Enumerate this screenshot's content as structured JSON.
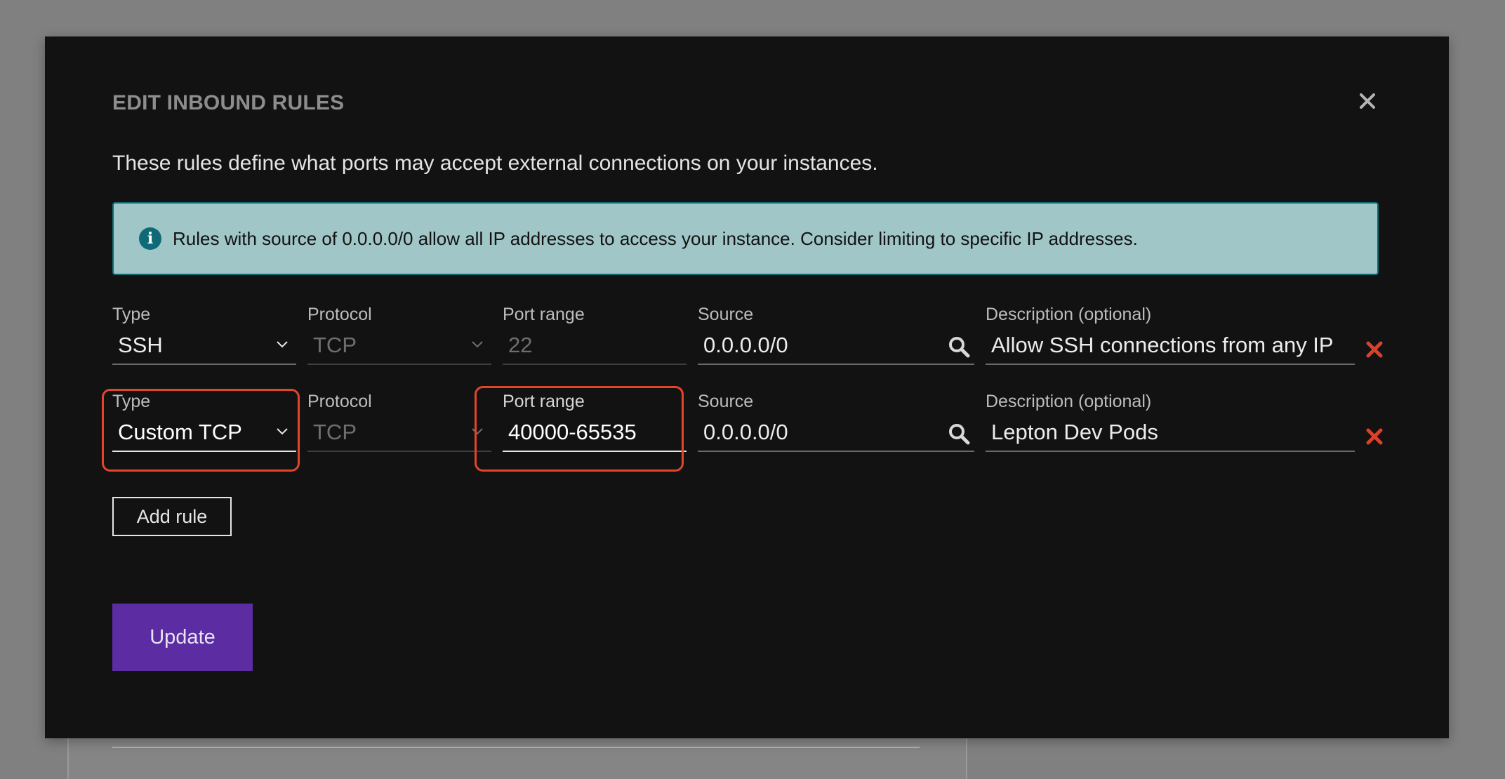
{
  "modal": {
    "title": "EDIT INBOUND RULES",
    "subtitle": "These rules define what ports may accept external connections on your instances.",
    "info_message": "Rules with source of 0.0.0.0/0 allow all IP addresses to access your instance. Consider limiting to specific IP addresses.",
    "close_icon": "close-icon",
    "add_rule_label": "Add rule",
    "update_label": "Update"
  },
  "labels": {
    "type": "Type",
    "protocol": "Protocol",
    "port_range": "Port range",
    "source": "Source",
    "description": "Description (optional)"
  },
  "rules": [
    {
      "type": "SSH",
      "protocol": "TCP",
      "port_range": "22",
      "source": "0.0.0.0/0",
      "description": "Allow SSH connections from any IP"
    },
    {
      "type": "Custom TCP",
      "protocol": "TCP",
      "port_range": "40000-65535",
      "source": "0.0.0.0/0",
      "description": "Lepton Dev Pods"
    }
  ],
  "colors": {
    "modal_bg": "#121212",
    "info_bg": "#a0c6c7",
    "info_border": "#116a72",
    "update_button": "#5b2ca2",
    "remove_icon": "#d9412b",
    "highlight_outline": "#e2452c"
  }
}
